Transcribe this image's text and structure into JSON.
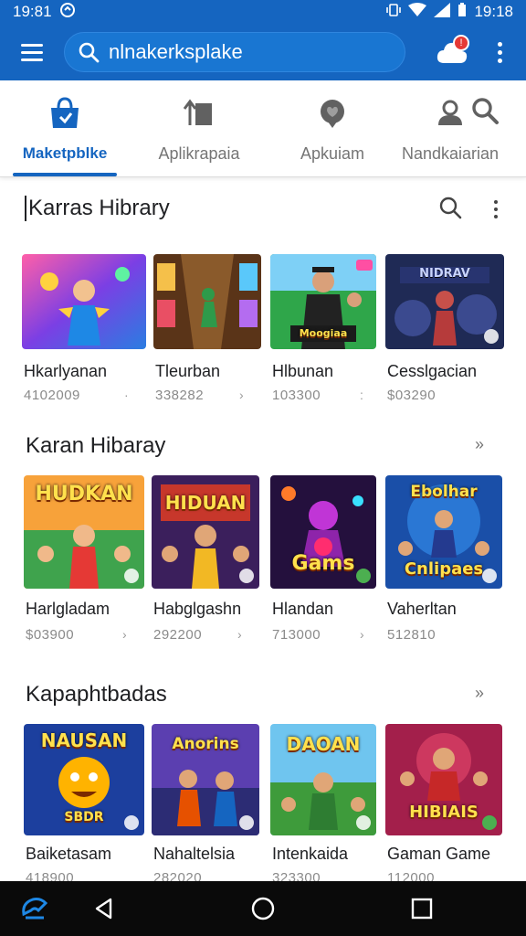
{
  "status_bar": {
    "left_time": "19:81",
    "right_time": "19:18"
  },
  "search": {
    "value": "nlnakerksplake"
  },
  "notification_badge": "!",
  "tabs": [
    {
      "label": "Maketpblke",
      "icon": "bag-icon",
      "active": true
    },
    {
      "label": "Aplikrapaia",
      "icon": "upload-icon",
      "active": false
    },
    {
      "label": "Apkuiam",
      "icon": "heart-icon",
      "active": false
    },
    {
      "label": "Nandkaiarian",
      "icon": "person-icon",
      "active": false
    }
  ],
  "sections": [
    {
      "title": "Karras Hibrary",
      "cards": [
        {
          "title": "Hkarlyanan",
          "meta": "4102009",
          "chevron": "·"
        },
        {
          "title": "Tleurban",
          "meta": "338282",
          "chevron": "›"
        },
        {
          "title": "Hlbunan",
          "meta": "103300",
          "chevron": ":"
        },
        {
          "title": "Cesslgacian",
          "meta": "$03290",
          "chevron": ""
        }
      ]
    },
    {
      "title": "Karan Hibaray",
      "see_more": "››",
      "cards": [
        {
          "title": "Harlgladam",
          "meta": "$03900",
          "chevron": "›",
          "art_caption": "HUDKAN"
        },
        {
          "title": "Habglgashn",
          "meta": "292200",
          "chevron": "›",
          "art_caption": "HIDUAN"
        },
        {
          "title": "Hlandan",
          "meta": "713000",
          "chevron": "›",
          "art_caption": "Gams"
        },
        {
          "title": "Vaherltan",
          "meta": "512810",
          "chevron": "",
          "art_caption": "Cnlipaes"
        }
      ]
    },
    {
      "title": "Kapaphtbadas",
      "see_more": "››",
      "cards": [
        {
          "title": "Baiketasam",
          "meta": "418900",
          "chevron": "",
          "art_caption": "NAUSAN"
        },
        {
          "title": "Nahaltelsia",
          "meta": "282020",
          "chevron": "",
          "art_caption": "Anorins"
        },
        {
          "title": "Intenkaida",
          "meta": "323300",
          "chevron": "",
          "art_caption": "DAOAN"
        },
        {
          "title": "Gaman Game",
          "meta": "112000",
          "chevron": "",
          "art_caption": "HIBIAIS"
        }
      ]
    }
  ],
  "colors": {
    "brand": "#1565c0",
    "brand_light": "#1976d2",
    "badge": "#e53935",
    "nav_bar": "#0a0a0a"
  }
}
